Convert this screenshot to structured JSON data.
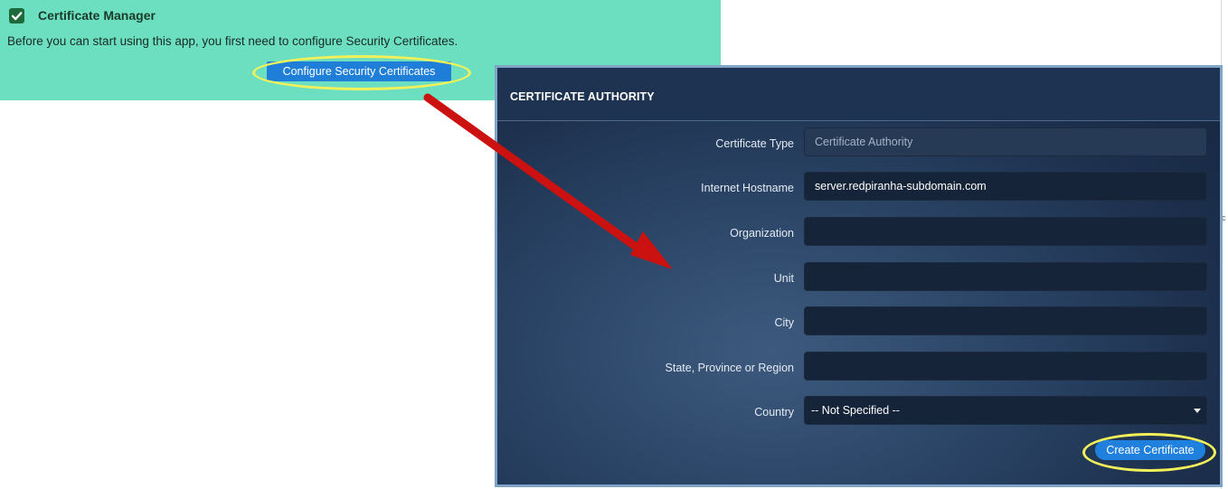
{
  "notice": {
    "title": "Certificate Manager",
    "text": "Before you can start using this app, you first need to configure Security Certificates.",
    "button_label": "Configure Security Certificates",
    "icon": "check-square-icon",
    "background_color": "#6bdfbf"
  },
  "panel": {
    "title": "CERTIFICATE AUTHORITY",
    "fields": [
      {
        "label": "Certificate Type",
        "value": "Certificate Authority",
        "placeholder": "",
        "readonly": true
      },
      {
        "label": "Internet Hostname",
        "value": "server.redpiranha-subdomain.com",
        "placeholder": "",
        "readonly": false
      },
      {
        "label": "Organization",
        "value": "",
        "placeholder": "",
        "readonly": false
      },
      {
        "label": "Unit",
        "value": "",
        "placeholder": "",
        "readonly": false
      },
      {
        "label": "City",
        "value": "",
        "placeholder": "",
        "readonly": false
      },
      {
        "label": "State, Province or Region",
        "value": "",
        "placeholder": "",
        "readonly": false
      }
    ],
    "country": {
      "label": "Country",
      "selected": "-- Not Specified --"
    },
    "create_button_label": "Create Certificate"
  },
  "annotations": {
    "arrow_color": "#cc1111",
    "highlight_color": "#f3f15a",
    "edge_glyph": "c"
  },
  "colors": {
    "accent_button": "#1f7fd8",
    "panel_background": "#1c2f4c"
  }
}
